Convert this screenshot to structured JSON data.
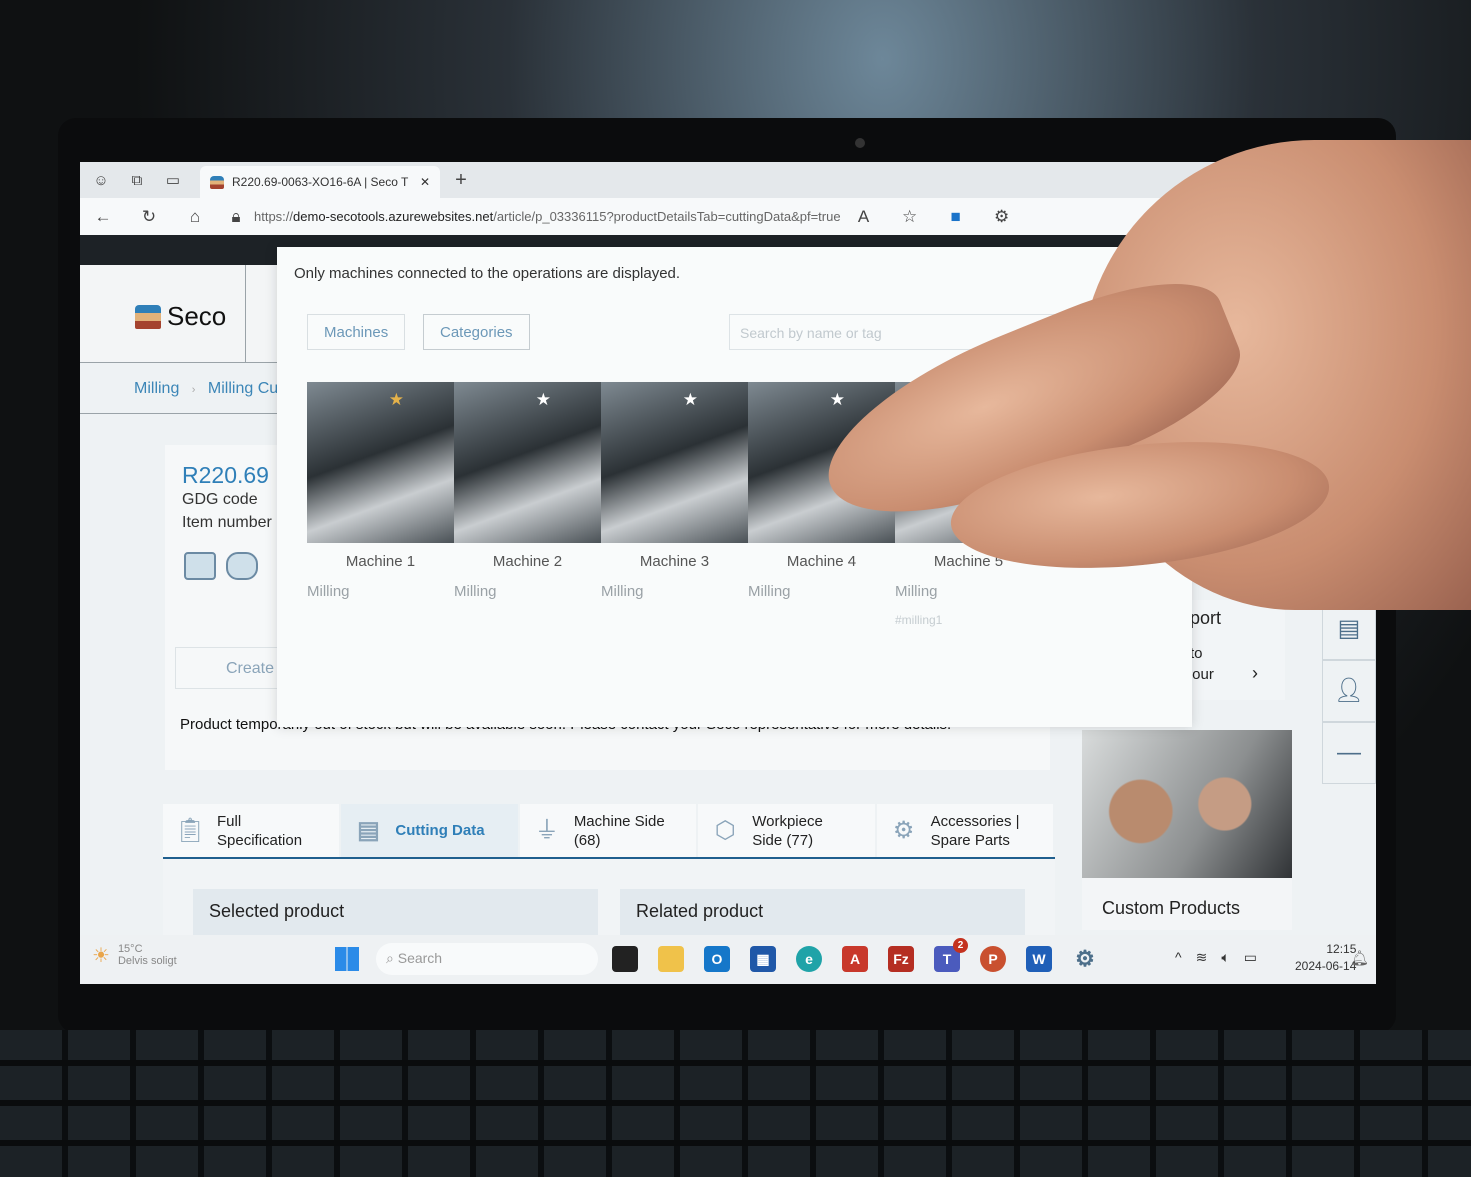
{
  "browser": {
    "tab_title": "R220.69-0063-XO16-6A | Seco T",
    "url_prefix": "https://",
    "url_domain": "demo-secotools.azurewebsites.net",
    "url_path": "/article/p_03336115?productDetailsTab=cuttingData&pf=true",
    "icons": [
      "profile-icon",
      "collections-icon",
      "tab-actions-icon",
      "back-icon",
      "refresh-icon",
      "home-icon",
      "lock-icon",
      "read-aloud-icon",
      "favorite-icon",
      "extension-icon"
    ]
  },
  "site": {
    "logo": "Seco",
    "breadcrumb": [
      "Milling",
      "Milling Cu"
    ],
    "product": {
      "code": "R220.69",
      "gdg_label": "GDG code",
      "item_label": "Item number",
      "create_label": "Create"
    },
    "stock_message": "Product temporarily out of stock but will be available soon. Please contact your Seco representative for more details.",
    "tabs": [
      {
        "label": "Full Specification",
        "icon": "clipboard-icon"
      },
      {
        "label": "Cutting Data",
        "icon": "cutting-data-icon",
        "active": true
      },
      {
        "label": "Machine Side (68)",
        "icon": "machine-spindle-icon"
      },
      {
        "label": "Workpiece Side (77)",
        "icon": "workpiece-icon"
      },
      {
        "label": "Accessories | Spare Parts",
        "icon": "bolt-nut-icon"
      }
    ],
    "selected_product": "Selected product",
    "related_product": "Related product",
    "support": {
      "title": "port",
      "line1": "to",
      "line2": "r our"
    },
    "custom_products": "Custom Products",
    "accent": "#2f7fb8"
  },
  "modal": {
    "note": "Only machines connected to the operations are displayed.",
    "tabs": [
      "Machines",
      "Categories"
    ],
    "search_placeholder": "Search by name or tag",
    "machines": [
      {
        "name": "Machine 1",
        "category": "Milling",
        "favorite": true,
        "tag": ""
      },
      {
        "name": "Machine 2",
        "category": "Milling",
        "favorite": false,
        "tag": ""
      },
      {
        "name": "Machine 3",
        "category": "Milling",
        "favorite": false,
        "tag": ""
      },
      {
        "name": "Machine 4",
        "category": "Milling",
        "favorite": false,
        "tag": ""
      },
      {
        "name": "Machine 5",
        "category": "Milling",
        "favorite": false,
        "tag": "#milling1"
      }
    ]
  },
  "taskbar": {
    "temperature": "15°C",
    "weather": "Delvis soligt",
    "search_placeholder": "Search",
    "teams_badge": "2",
    "time": "12:15",
    "date": "2024-06-14"
  }
}
